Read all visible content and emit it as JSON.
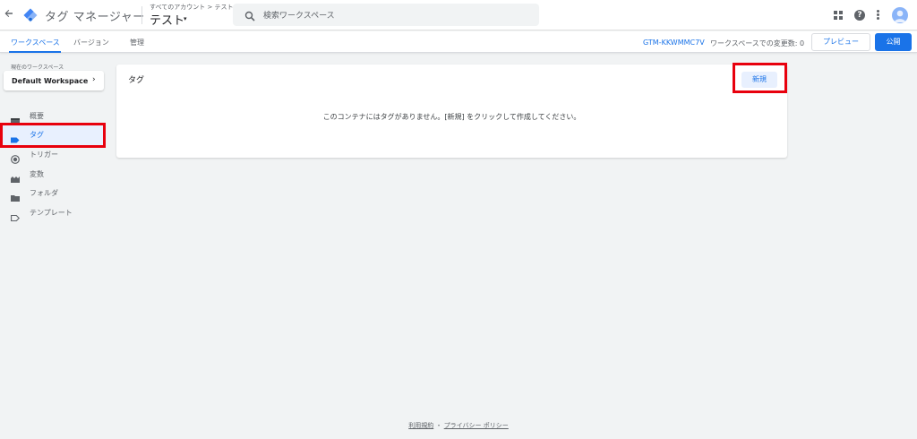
{
  "header": {
    "back_icon": "arrow-back-icon",
    "logo_icon": "tag-manager-logo-icon",
    "app_title": "タグ マネージャー",
    "breadcrumb": "すべてのアカウント > テスト",
    "container_name": "テスト",
    "container_caret": "▾",
    "search_placeholder": "検索ワークスペース",
    "icons": [
      "search-icon",
      "apps-icon",
      "help-icon",
      "more-vert-icon",
      "avatar"
    ],
    "help_glyph": "?"
  },
  "nav": {
    "tabs": [
      {
        "label": "ワークスペース",
        "active": true
      },
      {
        "label": "バージョン",
        "active": false
      },
      {
        "label": "管理",
        "active": false
      }
    ],
    "container_id": "GTM-KKWMMC7V",
    "changes_text": "ワークスペースでの変更数: 0",
    "preview_label": "プレビュー",
    "publish_label": "公開"
  },
  "sidebar": {
    "workspace_label": "現在のワークスペース",
    "workspace_name": "Default Workspace",
    "workspace_chevron": "›",
    "items": [
      {
        "label": "概要",
        "icon": "overview-icon",
        "selected": false
      },
      {
        "label": "タグ",
        "icon": "tag-icon",
        "selected": true
      },
      {
        "label": "トリガー",
        "icon": "trigger-icon",
        "selected": false
      },
      {
        "label": "変数",
        "icon": "variable-icon",
        "selected": false
      },
      {
        "label": "フォルダ",
        "icon": "folder-icon",
        "selected": false
      },
      {
        "label": "テンプレート",
        "icon": "template-icon",
        "selected": false
      }
    ]
  },
  "main": {
    "card_title": "タグ",
    "new_button_label": "新規",
    "empty_message": "このコンテナにはタグがありません。[新規] をクリックして作成してください。"
  },
  "footer": {
    "terms": "利用規約",
    "separator": "・",
    "privacy": "プライバシー ポリシー"
  },
  "colors": {
    "accent": "#1a73e8",
    "highlight": "#e8000d",
    "selected_bg": "#e8f0fe"
  }
}
